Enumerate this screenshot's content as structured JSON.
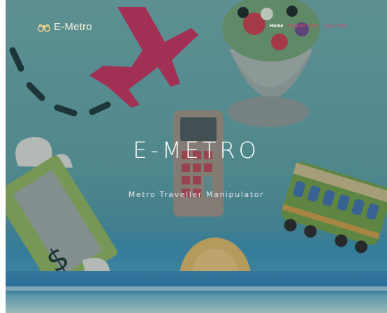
{
  "brand": {
    "name": "E-Metro",
    "icon": "binoculars-icon"
  },
  "nav": {
    "items": [
      {
        "label": "Home",
        "active": true
      },
      {
        "label": "Register Here",
        "active": false
      },
      {
        "label": "Login Here",
        "active": false
      }
    ]
  },
  "hero": {
    "title": "E-METRO",
    "subtitle": "Metro Traveller Manipulator"
  },
  "colors": {
    "background": "#5b9da1",
    "brand_text": "#f4f2da",
    "nav_link": "#c94d6e",
    "nav_active": "#ffffff"
  }
}
